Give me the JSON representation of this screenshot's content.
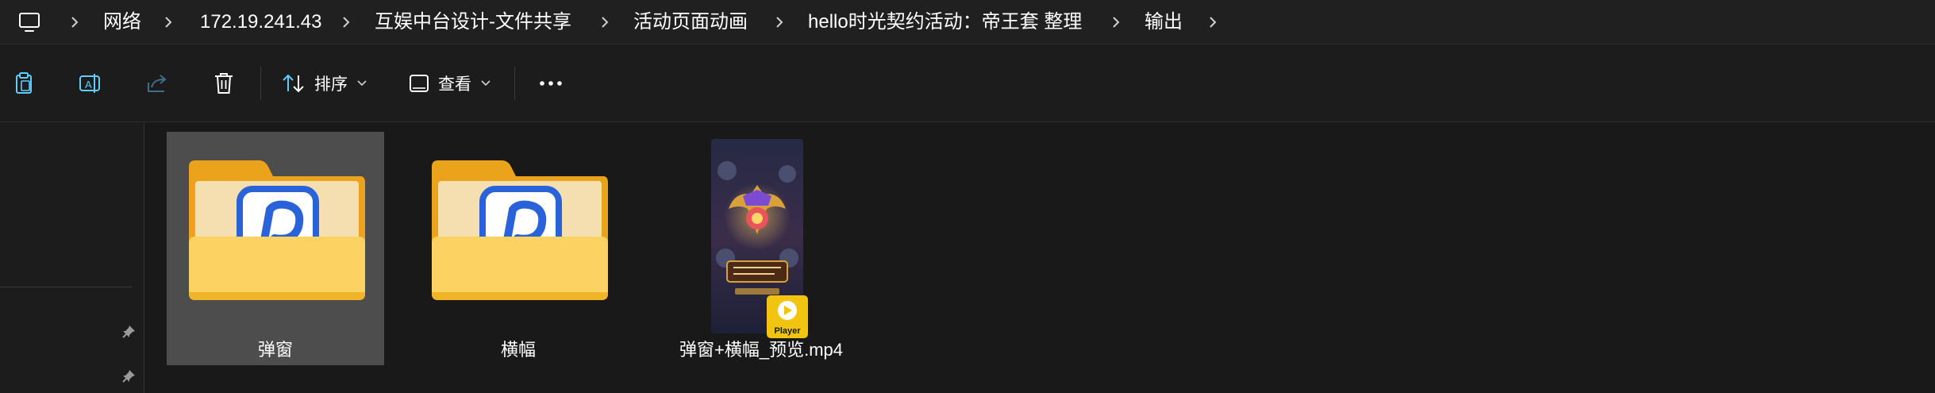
{
  "breadcrumb": {
    "root_icon": "computer-icon",
    "items": [
      "网络",
      "172.19.241.43",
      "互娱中台设计-文件共享",
      "活动页面动画",
      "hello时光契约活动：帝王套 整理",
      "输出"
    ]
  },
  "toolbar": {
    "icons": [
      "paste-icon",
      "rename-icon",
      "share-icon",
      "delete-icon"
    ],
    "sort_label": "排序",
    "view_label": "查看",
    "more_icon": "more-icon"
  },
  "files": [
    {
      "name": "弹窗",
      "type": "folder",
      "selected": true
    },
    {
      "name": "横幅",
      "type": "folder",
      "selected": false
    },
    {
      "name": "弹窗+横幅_预览.mp4",
      "type": "video",
      "selected": false,
      "badge": "Player"
    }
  ],
  "colors": {
    "background": "#191919",
    "selection": "#4d4d4d",
    "folder": "#f8c94a",
    "accent": "#60cdff",
    "badge": "#f1c40f"
  }
}
